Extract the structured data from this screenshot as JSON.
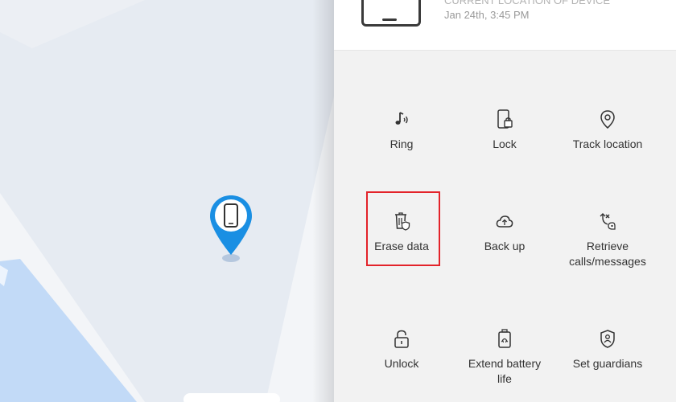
{
  "colors": {
    "accent": "#1a8fe3",
    "highlight": "#e3232a",
    "map_land": "#e6ebf2",
    "map_water": "#c2daf7"
  },
  "device": {
    "subtitle": "CURRENT LOCATION OF DEVICE",
    "timestamp": "Jan 24th, 3:45 PM"
  },
  "map": {
    "pin_icon": "phone-location-pin-icon"
  },
  "actions": [
    {
      "label": "Ring",
      "icon": "ring-icon"
    },
    {
      "label": "Lock",
      "icon": "lock-icon"
    },
    {
      "label": "Track location",
      "icon": "location-pin-icon"
    },
    {
      "label": "Erase data",
      "icon": "erase-data-icon"
    },
    {
      "label": "Back up",
      "icon": "cloud-backup-icon"
    },
    {
      "label": "Retrieve\ncalls/messages",
      "icon": "retrieve-calls-icon"
    },
    {
      "label": "Unlock",
      "icon": "unlock-icon"
    },
    {
      "label": "Extend battery\nlife",
      "icon": "battery-icon"
    },
    {
      "label": "Set guardians",
      "icon": "guardian-shield-icon"
    }
  ]
}
